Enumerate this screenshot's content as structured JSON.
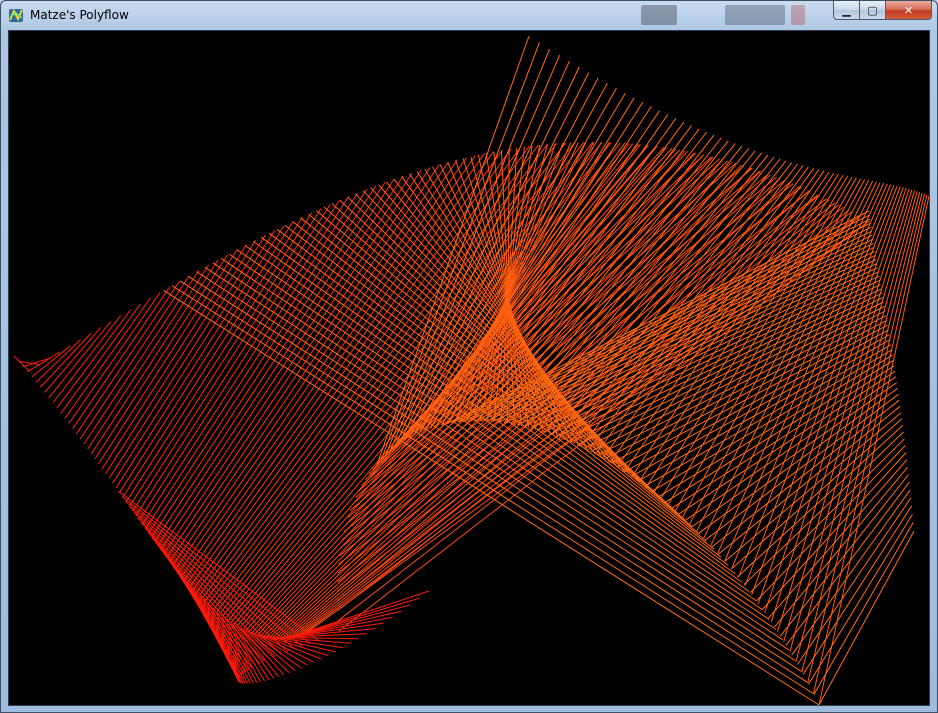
{
  "window": {
    "title": "Matze's Polyflow",
    "icon": "polyflow-app-icon",
    "controls": {
      "minimize_icon": "minimize-icon",
      "maximize_icon": "maximize-icon",
      "close_icon": "close-icon",
      "minimize_glyph": "▁",
      "maximize_glyph": "▢",
      "close_glyph": "✕"
    }
  },
  "canvas": {
    "background": "#000000",
    "colors": {
      "red": "#ff1a0a",
      "orange": "#ff6e12",
      "deep_orange": "#ff4a10"
    }
  }
}
